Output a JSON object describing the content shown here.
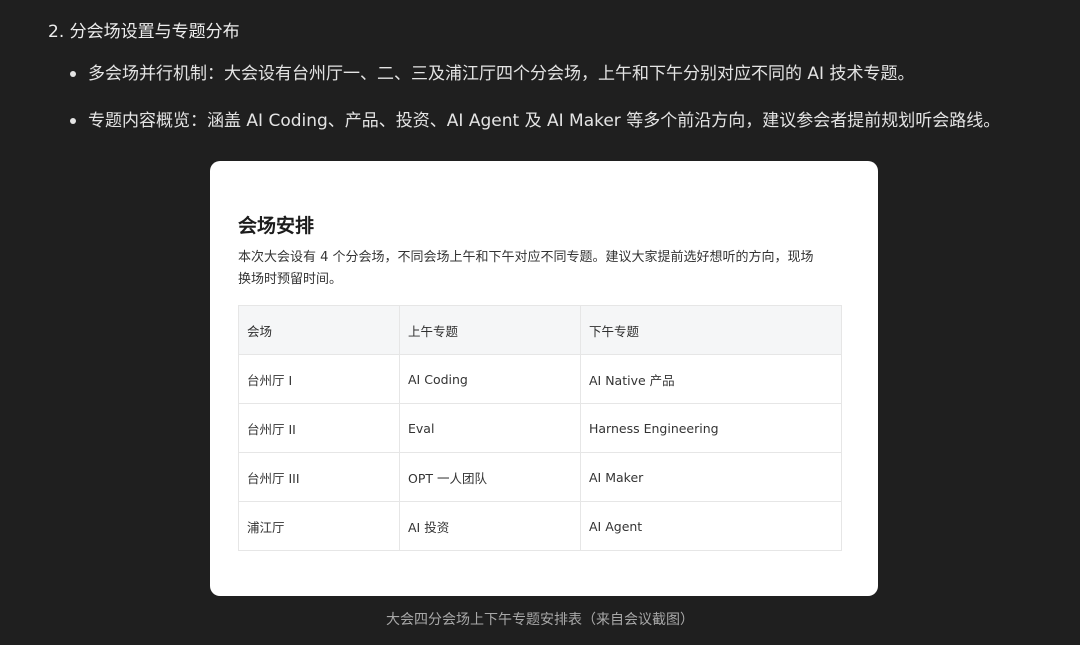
{
  "section": {
    "heading": "2. 分会场设置与专题分布"
  },
  "bullets": [
    {
      "text": "多会场并行机制：大会设有台州厅一、二、三及浦江厅四个分会场，上午和下午分别对应不同的 AI 技术专题。"
    },
    {
      "text": "专题内容概览：涵盖 AI Coding、产品、投资、AI Agent 及 AI Maker 等多个前沿方向，建议参会者提前规划听会路线。"
    }
  ],
  "card": {
    "title": "会场安排",
    "description": "本次大会设有 4 个分会场，不同会场上午和下午对应不同专题。建议大家提前选好想听的方向，现场换场时预留时间。",
    "table": {
      "headers": [
        "会场",
        "上午专题",
        "下午专题"
      ],
      "rows": [
        [
          "台州厅 I",
          "AI Coding",
          "AI Native 产品"
        ],
        [
          "台州厅 II",
          "Eval",
          "Harness Engineering"
        ],
        [
          "台州厅 III",
          "OPT 一人团队",
          "AI Maker"
        ],
        [
          "浦江厅",
          "AI 投资",
          "AI Agent"
        ]
      ]
    }
  },
  "caption": "大会四分会场上下午专题安排表（来自会议截图）"
}
